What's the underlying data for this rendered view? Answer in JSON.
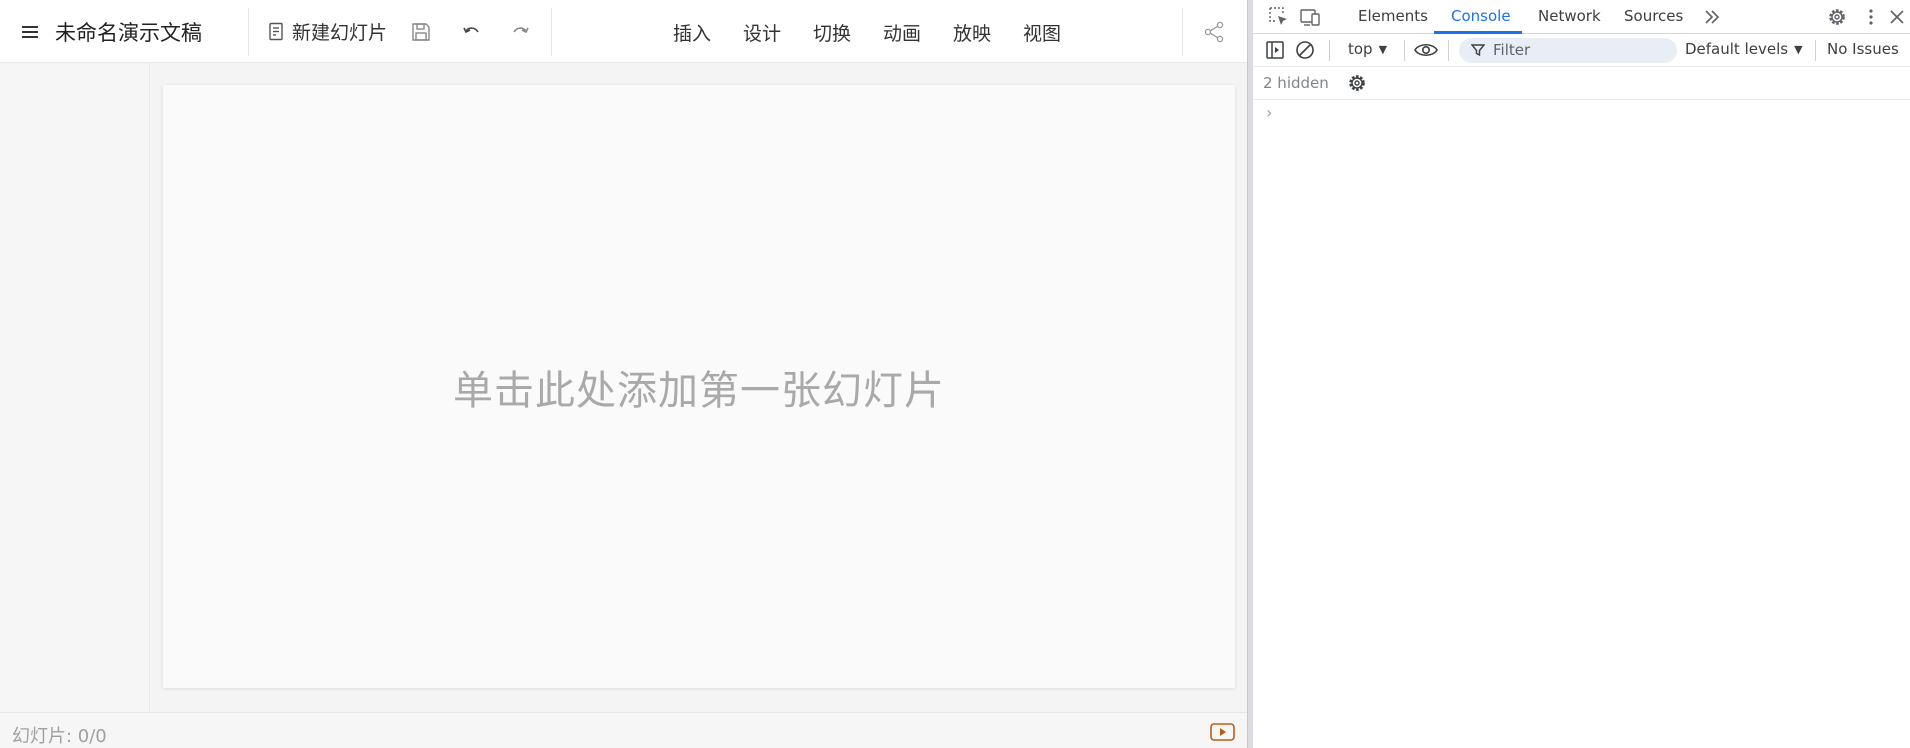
{
  "app": {
    "doc_title": "未命名演示文稿",
    "new_slide_label": "新建幻灯片",
    "nav": [
      "插入",
      "设计",
      "切换",
      "动画",
      "放映",
      "视图"
    ],
    "slide_hint": "单击此处添加第一张幻灯片",
    "slide_count": "幻灯片: 0/0"
  },
  "devtools": {
    "tabs": [
      "Elements",
      "Console",
      "Network",
      "Sources"
    ],
    "active_tab": "Console",
    "context": "top",
    "filter_placeholder": "Filter",
    "levels": "Default levels",
    "issues": "No Issues",
    "hidden": "2 hidden",
    "prompt": "›"
  },
  "colors": {
    "accent": "#1a73e8",
    "play_button": "#c25b12",
    "slide_hint": "#a9a9a9"
  },
  "icons": {
    "menu": "hamburger-icon",
    "new_slide": "document-icon",
    "save": "save-icon",
    "undo": "undo-icon",
    "redo": "redo-icon",
    "share": "share-icon",
    "play": "play-icon",
    "inspect": "inspect-element-icon",
    "device": "device-toolbar-icon",
    "more_tabs": "chevron-double-right-icon",
    "settings": "gear-icon",
    "kebab": "kebab-menu-icon",
    "close": "close-icon",
    "sidebar": "sidebar-toggle-icon",
    "clear": "clear-console-icon",
    "eye": "eye-icon",
    "filter": "filter-icon"
  }
}
